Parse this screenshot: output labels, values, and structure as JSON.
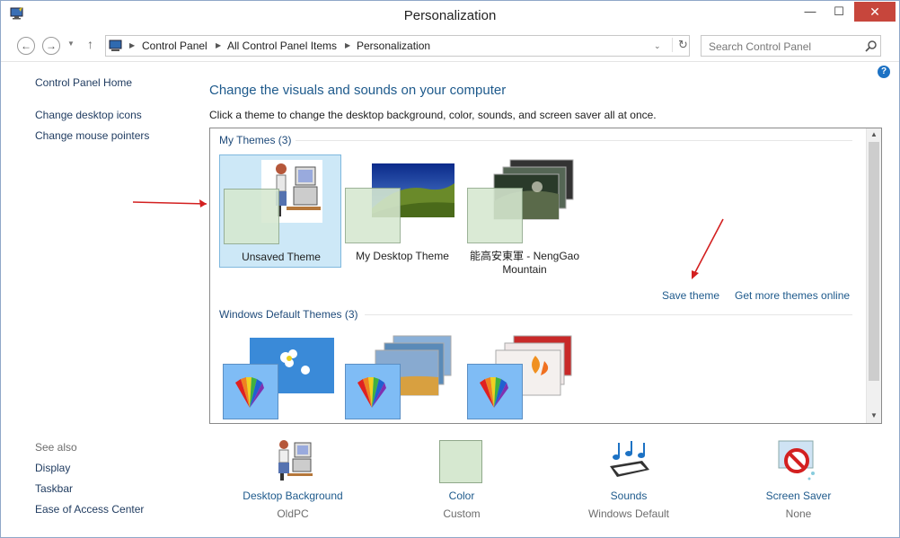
{
  "window": {
    "title": "Personalization",
    "minimize": "—",
    "maximize": "☐",
    "close": "✕"
  },
  "breadcrumb": [
    "Control Panel",
    "All Control Panel Items",
    "Personalization"
  ],
  "search": {
    "placeholder": "Search Control Panel"
  },
  "sidebar": {
    "home": "Control Panel Home",
    "links": [
      "Change desktop icons",
      "Change mouse pointers"
    ],
    "see_also_label": "See also",
    "see_also": [
      "Display",
      "Taskbar",
      "Ease of Access Center"
    ]
  },
  "main": {
    "heading": "Change the visuals and sounds on your computer",
    "subheading": "Click a theme to change the desktop background, color, sounds, and screen saver all at once.",
    "my_themes_label": "My Themes (3)",
    "my_themes": [
      {
        "name": "Unsaved Theme"
      },
      {
        "name": "My Desktop Theme"
      },
      {
        "name": "能高安東軍 - NengGao Mountain"
      }
    ],
    "save_theme": "Save theme",
    "get_more": "Get more themes online",
    "default_themes_label": "Windows Default Themes (3)"
  },
  "bottom": [
    {
      "label": "Desktop Background",
      "value": "OldPC"
    },
    {
      "label": "Color",
      "value": "Custom"
    },
    {
      "label": "Sounds",
      "value": "Windows Default"
    },
    {
      "label": "Screen Saver",
      "value": "None"
    }
  ],
  "colors": {
    "link": "#1e5a8c",
    "selection": "#cde8f7",
    "accent_arrow": "#d32020"
  },
  "icons": [
    "app-icon",
    "back-icon",
    "forward-icon",
    "up-icon",
    "refresh-icon",
    "search-icon",
    "help-icon"
  ]
}
